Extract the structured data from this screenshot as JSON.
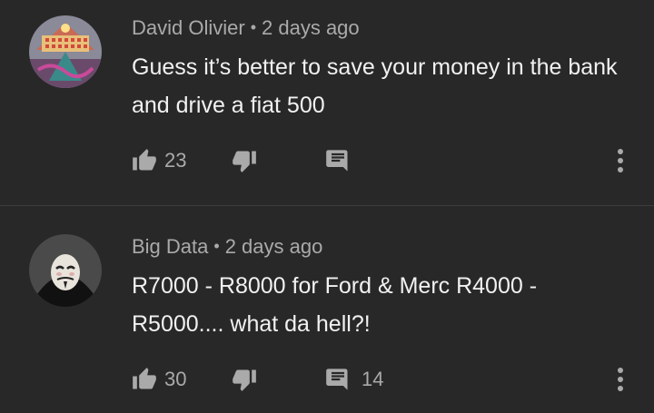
{
  "comments": [
    {
      "author": "David Olivier",
      "time": "2 days ago",
      "text": "Guess it’s better to save your money in the bank and drive a fiat 500",
      "likes": "23",
      "replies": "",
      "avatar_icon": "pyramid-art-avatar"
    },
    {
      "author": "Big Data",
      "time": "2 days ago",
      "text": "R7000 - R8000 for Ford & Merc R4000 - R5000.... what da hell?!",
      "likes": "30",
      "replies": "14",
      "avatar_icon": "guy-fawkes-mask-avatar"
    }
  ],
  "icons": {
    "like": "thumb-up-icon",
    "dislike": "thumb-down-icon",
    "reply": "reply-comment-icon",
    "more": "more-vertical-icon"
  },
  "colors": {
    "background": "#282828",
    "meta": "#aaaaaa",
    "text": "#f1f1f1"
  }
}
